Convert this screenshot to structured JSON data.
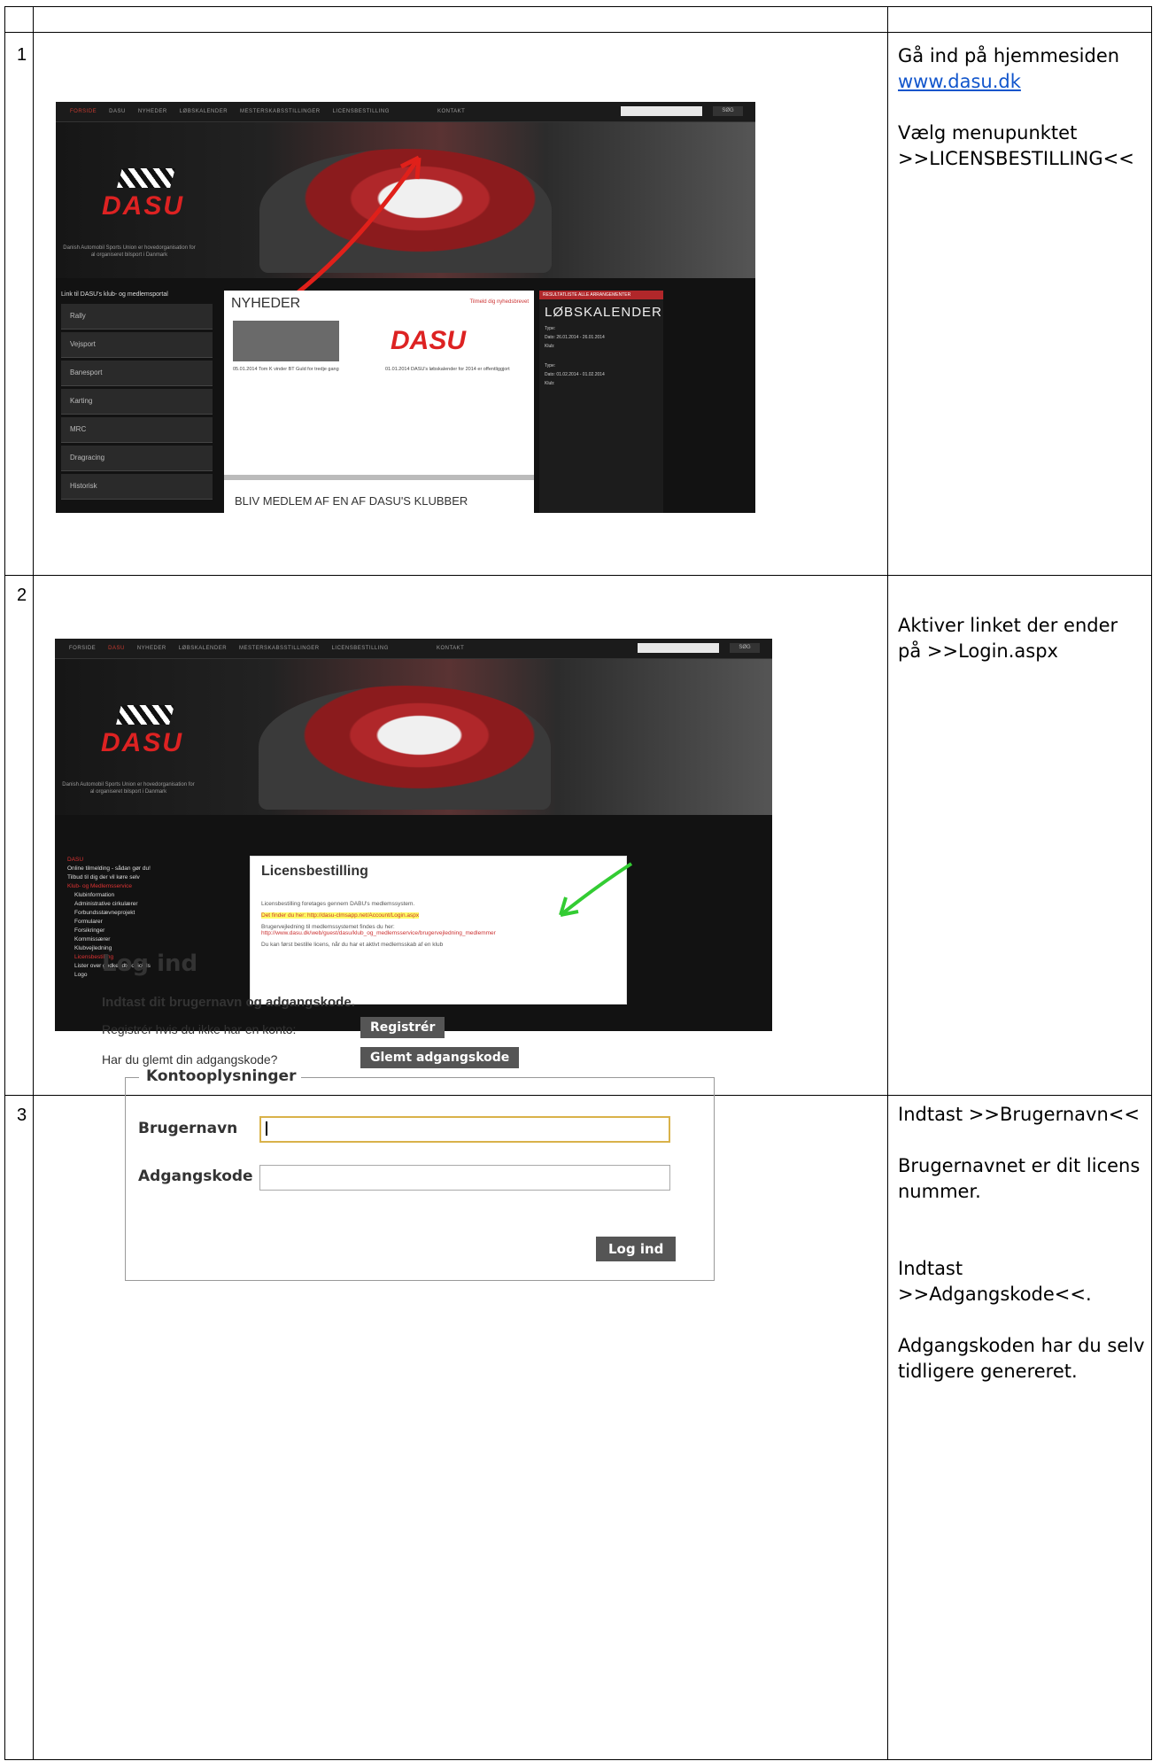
{
  "rows": [
    {
      "num": "1",
      "instructions": [
        "Gå ind på hjemmesiden",
        "www.dasu.dk",
        "Vælg menupunktet >>LICENSBESTILLING<<"
      ]
    },
    {
      "num": "2",
      "instructions": [
        "Aktiver linket der ender på >>Login.aspx"
      ]
    },
    {
      "num": "3",
      "instructions": [
        "Indtast >>Brugernavn<<",
        "Brugernavnet er dit licens nummer.",
        "Indtast >>Adgangskode<<.",
        "Adgangskoden har du selv tidligere genereret."
      ]
    }
  ],
  "shot1": {
    "nav": [
      "FORSIDE",
      "DASU",
      "NYHEDER",
      "LØBSKALENDER",
      "MESTERSKABSSTILLINGER",
      "LICENSBESTILLING",
      "KONTAKT"
    ],
    "search_button": "SØG",
    "logo": "DASU",
    "tagline": "Danish Automobil Sports Union er hovedorganisation for al organiseret bilsport i Danmark",
    "menu_title": "Link til DASU's klub- og medlemsportal",
    "menu": [
      "Rally",
      "Vejsport",
      "Banesport",
      "Karting",
      "MRC",
      "Dragracing",
      "Historisk"
    ],
    "news_title": "NYHEDER",
    "news_more": "Tilmeld dig nyhedsbrevet",
    "news_logo": "DASU",
    "news1": "05.01.2014 Tom K vinder BT Guld for tredje gang",
    "news2": "01.01.2014 DASU's løbskalender for 2014 er offentliggjort",
    "join": "BLIV MEDLEM AF EN AF DASU'S KLUBBER",
    "cal_header": "RESULTATLISTE   ALLE ARRANGEMENTER",
    "cal_title": "LØBSKALENDER",
    "cal_rows": [
      "Type: ",
      "Dato: 26.01.2014 - 26.01.2014",
      "Klub: ",
      "Type: ",
      "Dato: 01.02.2014 - 01.02.2014",
      "Klub: "
    ]
  },
  "shot2": {
    "menu": [
      "DASU",
      "Online tilmelding - sådan gør du!",
      "Tilbud til dig der vil køre selv",
      "Klub- og Medlemsservice",
      "Klubinformation",
      "Administrative cirkulærer",
      "Forbundsstævneprojekt",
      "Formularer",
      "Forsikringer",
      "Kommissærer",
      "Klubvejledning",
      "Licensbestilling",
      "Lister over godkendte officials",
      "Logo"
    ],
    "box_title": "Licensbestilling",
    "line1": "Licensbestilling foretages gennem DABU's medlemssystem.",
    "line2": "Det finder du her: http://dasu-clmsapp.net/Account/Login.aspx",
    "line3": "Brugervejledning til medlemssystemet findes du her:",
    "line3b": "http://www.dasu.dk/web/guest/dasu/klub_og_medlemsservice/brugervejledning_medlemmer",
    "line4": "Du kan først bestille licens, når du har et aktivt medlemsskab af en klub"
  },
  "login": {
    "title": "Log ind",
    "subtitle": "Indtast dit brugernavn og adgangskode.",
    "register_text": "Registrér hvis du ikke har en konto:",
    "register_button": "Registrér",
    "forgot_text": "Har du glemt din adgangskode?",
    "forgot_button": "Glemt adgangskode",
    "legend": "Kontooplysninger",
    "username_label": "Brugernavn",
    "password_label": "Adgangskode",
    "submit": "Log ind",
    "username_value": "",
    "password_value": ""
  }
}
